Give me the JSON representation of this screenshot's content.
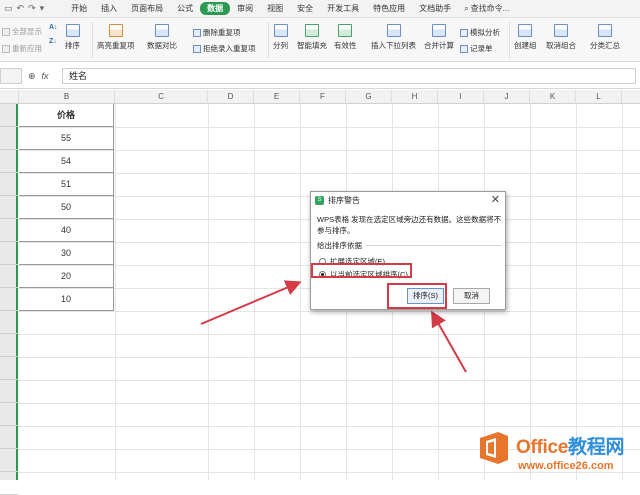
{
  "menubar": {
    "tabs": [
      {
        "label": "开始",
        "active": false
      },
      {
        "label": "插入",
        "active": false
      },
      {
        "label": "页面布局",
        "active": false
      },
      {
        "label": "公式",
        "active": false
      },
      {
        "label": "数据",
        "active": true
      },
      {
        "label": "审阅",
        "active": false
      },
      {
        "label": "视图",
        "active": false
      },
      {
        "label": "安全",
        "active": false
      },
      {
        "label": "开发工具",
        "active": false
      },
      {
        "label": "特色应用",
        "active": false
      },
      {
        "label": "文档助手",
        "active": false
      }
    ],
    "search_label": "查找命令..."
  },
  "ribbon": {
    "show_all": "全部显示",
    "reapply": "重新应用",
    "sort": "排序",
    "highlight_duplicates": "高亮重复项",
    "data_compare": "数据对比",
    "remove_duplicates": "删除重复项",
    "reject_duplicates": "拒绝录入重复项",
    "split": "分列",
    "smart_fill": "智能填充",
    "validity": "有效性",
    "insert_dropdown": "插入下拉列表",
    "consolidate": "合并计算",
    "what_if": "模拟分析",
    "record_sheet": "记录单",
    "create_group": "创建组",
    "ungroup": "取消组合",
    "subtotal": "分类汇总"
  },
  "formulabar": {
    "fx": "fx",
    "value": "姓名"
  },
  "grid": {
    "columns": [
      "B",
      "C",
      "D",
      "E",
      "F",
      "G",
      "H",
      "I",
      "J",
      "K",
      "L"
    ],
    "header_cell": "价格",
    "values": [
      "55",
      "54",
      "51",
      "50",
      "40",
      "30",
      "20",
      "10"
    ]
  },
  "dialog": {
    "title": "排序警告",
    "message": "WPS表格 发现在选定区域旁边还有数据。这些数据将不参与排序。",
    "group_label": "给出排序依据",
    "options": [
      {
        "label": "扩展选定区域(E)",
        "selected": false
      },
      {
        "label": "以当前选定区域排序(C)",
        "selected": true
      }
    ],
    "sort_button": "排序(S)",
    "cancel_button": "取消"
  },
  "watermark": {
    "brand_en": "Office",
    "brand_cn": "教程网",
    "url": "www.office26.com"
  },
  "colors": {
    "accent": "#2a9a52",
    "highlight": "#d33b47",
    "watermark_orange": "#e8752c",
    "watermark_blue": "#2f8fd8"
  }
}
